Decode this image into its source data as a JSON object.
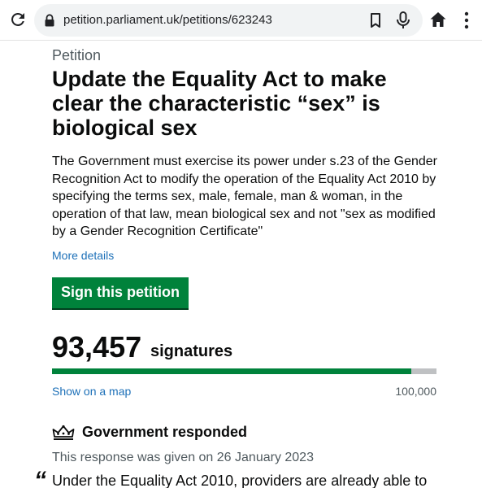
{
  "browser": {
    "url": "petition.parliament.uk/petitions/623243"
  },
  "petition": {
    "label": "Petition",
    "title": "Update the Equality Act to make clear the characteristic “sex” is biological sex",
    "description": "The Government must exercise its power under s.23 of the Gender Recognition Act to modify the operation of the Equality Act 2010 by specifying the terms sex, male, female, man & woman, in the operation of that law, mean biological sex and not \"sex as modified by a Gender Recognition Certificate\"",
    "more_details": "More details",
    "sign_button": "Sign this petition"
  },
  "signatures": {
    "count": "93,457",
    "label": "signatures",
    "progress_fraction": 0.93457,
    "show_map": "Show on a map",
    "target": "100,000"
  },
  "response": {
    "heading": "Government responded",
    "given": "This response was given on 26 January 2023",
    "quote_mark": "“",
    "text_start": "Under the Equality Act 2010, providers are already able to"
  },
  "colors": {
    "accent_green": "#00823b",
    "link_blue": "#1d70b8",
    "progress_track": "#bfc1c3"
  },
  "icons": {
    "reload": "reload-icon",
    "lock": "lock-icon",
    "bookmark": "bookmark-icon",
    "mic": "microphone-icon",
    "home": "home-icon",
    "menu": "more-menu-icon",
    "crown": "crown-icon"
  }
}
